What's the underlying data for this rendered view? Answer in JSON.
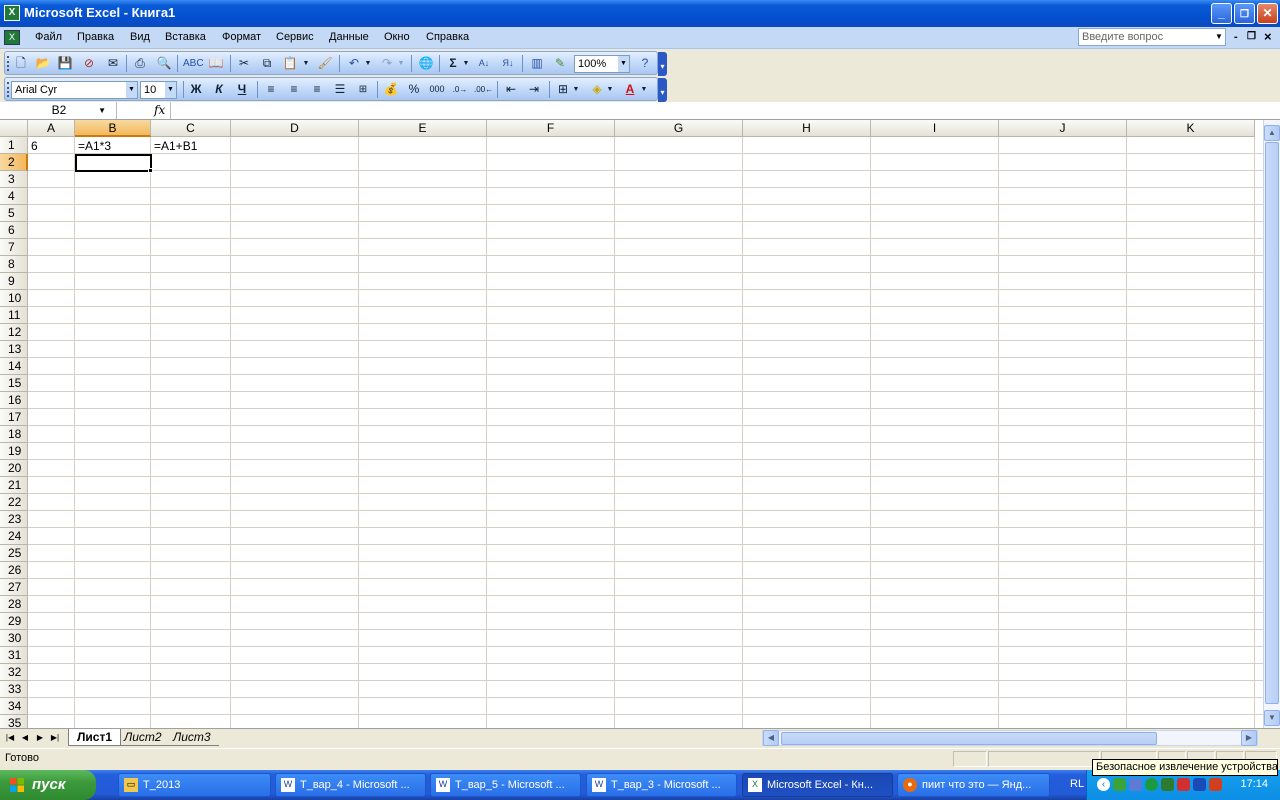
{
  "window": {
    "title": "Microsoft Excel - Книга1",
    "app_icon": "excel-icon",
    "min_label": "_",
    "max_label": "❐",
    "close_label": "✕"
  },
  "menu": {
    "items": [
      "Файл",
      "Правка",
      "Вид",
      "Вставка",
      "Формат",
      "Сервис",
      "Данные",
      "Окно",
      "Справка"
    ],
    "ask_placeholder": "Введите вопрос",
    "doc_min": "-",
    "doc_restore": "❐",
    "doc_close": "×"
  },
  "toolbar_standard": {
    "zoom": "100%",
    "icons": [
      "new-icon",
      "open-icon",
      "save-icon",
      "permission-icon",
      "print-icon",
      "print-preview-icon",
      "spelling-icon",
      "research-icon",
      "cut-icon",
      "copy-icon",
      "paste-icon",
      "format-painter-icon",
      "undo-icon",
      "redo-icon",
      "hyperlink-icon",
      "autosum-icon",
      "sort-ascending-icon",
      "sort-descending-icon",
      "chart-wizard-icon",
      "drawing-icon",
      "help-icon"
    ]
  },
  "toolbar_formatting": {
    "font": "Arial Cyr",
    "size": "10",
    "bold": "Ж",
    "italic": "К",
    "underline": "Ч",
    "percent": "%",
    "thousands": "000"
  },
  "formula_bar": {
    "name_box": "B2",
    "fx": "fx",
    "content": ""
  },
  "grid": {
    "columns": [
      "A",
      "B",
      "C",
      "D",
      "E",
      "F",
      "G",
      "H",
      "I",
      "J",
      "K"
    ],
    "selected_column": "B",
    "rows": [
      "1",
      "2",
      "3",
      "4",
      "5",
      "6",
      "7",
      "8",
      "9",
      "10",
      "11",
      "12",
      "13",
      "14",
      "15",
      "16",
      "17",
      "18",
      "19",
      "20",
      "21",
      "22",
      "23",
      "24",
      "25",
      "26",
      "27",
      "28",
      "29",
      "30",
      "31",
      "32",
      "33",
      "34",
      "35"
    ],
    "selected_row": "2",
    "cells": {
      "A1": "6",
      "B1": "=A1*3",
      "C1": "=A1+B1"
    },
    "active_cell": "B2"
  },
  "sheets": {
    "tabs": [
      "Лист1",
      "Лист2",
      "Лист3"
    ],
    "active": "Лист1"
  },
  "status": {
    "text": "Готово"
  },
  "taskbar": {
    "start_label": "пуск",
    "tasks": [
      {
        "label": "T_2013",
        "icon": "folder-icon"
      },
      {
        "label": "Т_вар_4 - Microsoft ...",
        "icon": "word-icon"
      },
      {
        "label": "Т_вар_5 - Microsoft ...",
        "icon": "word-icon"
      },
      {
        "label": "Т_вар_3 - Microsoft ...",
        "icon": "word-icon"
      },
      {
        "label": "Microsoft Excel - Кн...",
        "icon": "excel-icon"
      },
      {
        "label": "пиит что это — Янд...",
        "icon": "firefox-icon"
      }
    ],
    "active_task": 4,
    "lang": "RL",
    "clock": "17:14",
    "tooltip": "Безопасное извлечение устройства"
  }
}
